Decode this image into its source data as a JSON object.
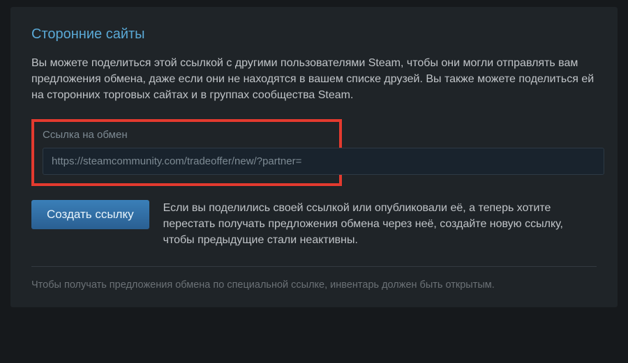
{
  "section": {
    "title": "Сторонние сайты",
    "description": "Вы можете поделиться этой ссылкой с другими пользователями Steam, чтобы они могли отправлять вам предложения обмена, даже если они не находятся в вашем списке друзей. Вы также можете поделиться ей на сторонних торговых сайтах и в группах сообщества Steam."
  },
  "trade_url": {
    "label": "Ссылка на обмен",
    "value": "https://steamcommunity.com/tradeoffer/new/?partner="
  },
  "create_link": {
    "button": "Создать ссылку",
    "help": "Если вы поделились своей ссылкой или опубликовали её, а теперь хотите перестать получать предложения обмена через неё, создайте новую ссылку, чтобы предыдущие стали неактивны."
  },
  "footer_note": "Чтобы получать предложения обмена по специальной ссылке, инвентарь должен быть открытым."
}
